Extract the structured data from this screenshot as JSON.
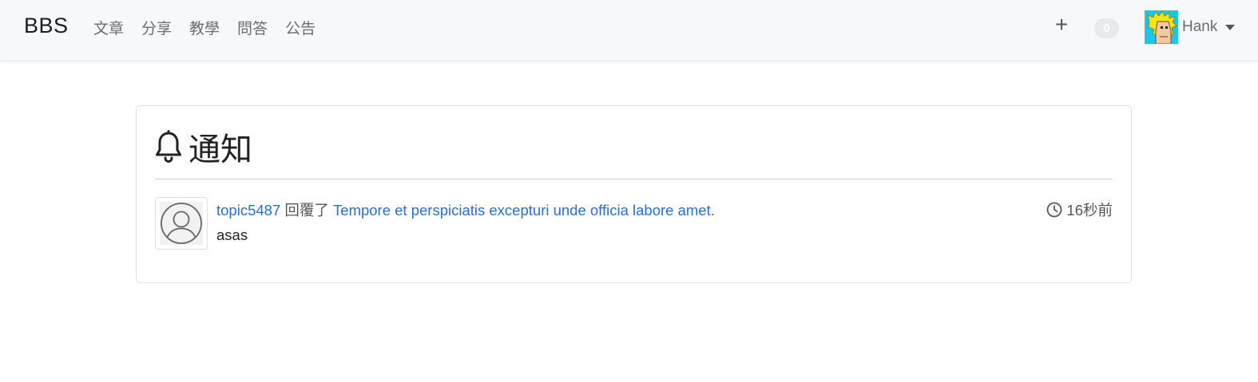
{
  "navbar": {
    "brand": "BBS",
    "links": [
      "文章",
      "分享",
      "教學",
      "問答",
      "公告"
    ],
    "plus_icon": "plus-icon",
    "notification_count": "0",
    "user_name": "Hank"
  },
  "page": {
    "title": "通知",
    "title_icon": "bell-icon"
  },
  "notifications": [
    {
      "user": "topic5487",
      "verb": "回覆了",
      "topic": "Tempore et perspiciatis excepturi unde officia labore amet.",
      "body": "asas",
      "time": "16秒前"
    }
  ],
  "colors": {
    "link": "#2a6fc9",
    "navbar_bg": "#f7f8fa",
    "badge_bg": "#e8e9eb"
  }
}
